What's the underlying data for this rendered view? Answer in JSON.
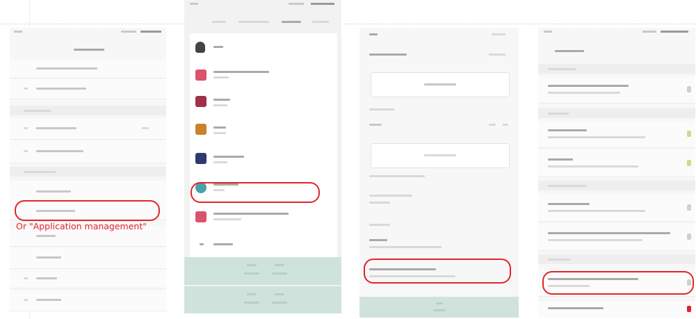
{
  "annotation": {
    "note": "Or \"Application management\"",
    "highlight_color": "#e0242a"
  },
  "phones": [
    {
      "name": "settings-screen"
    },
    {
      "name": "app-list-screen",
      "icon_colors": [
        "#444444",
        "#d9536b",
        "#a0304a",
        "#c9842b",
        "#2f3a6d",
        "#4aa3a8",
        "#d9536b",
        "#333333"
      ]
    },
    {
      "name": "app-info-screen"
    },
    {
      "name": "permissions-screen",
      "toggle_colors": [
        "#d0d0d0",
        "#d4d88a",
        "#d4d88a",
        "#d0d0d0",
        "#d0d0d0",
        "#d0d0d0",
        "#e0242a"
      ]
    }
  ]
}
